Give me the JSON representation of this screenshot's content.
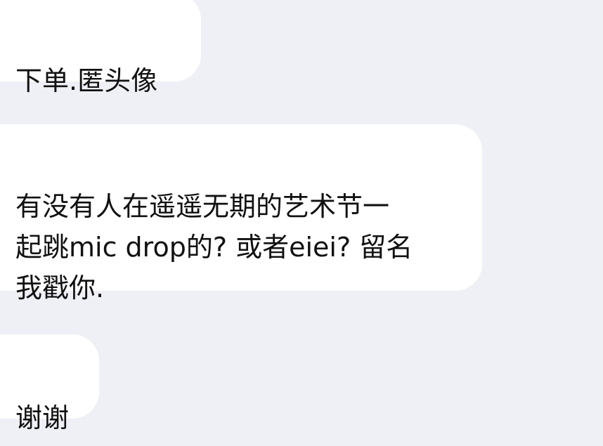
{
  "chat": {
    "messages": [
      {
        "text": "下单.匿头像"
      },
      {
        "text": "有没有人在遥遥无期的艺术节一\n起跳mic drop的? 或者eiei? 留名\n我戳你."
      },
      {
        "text": "谢谢"
      }
    ]
  }
}
